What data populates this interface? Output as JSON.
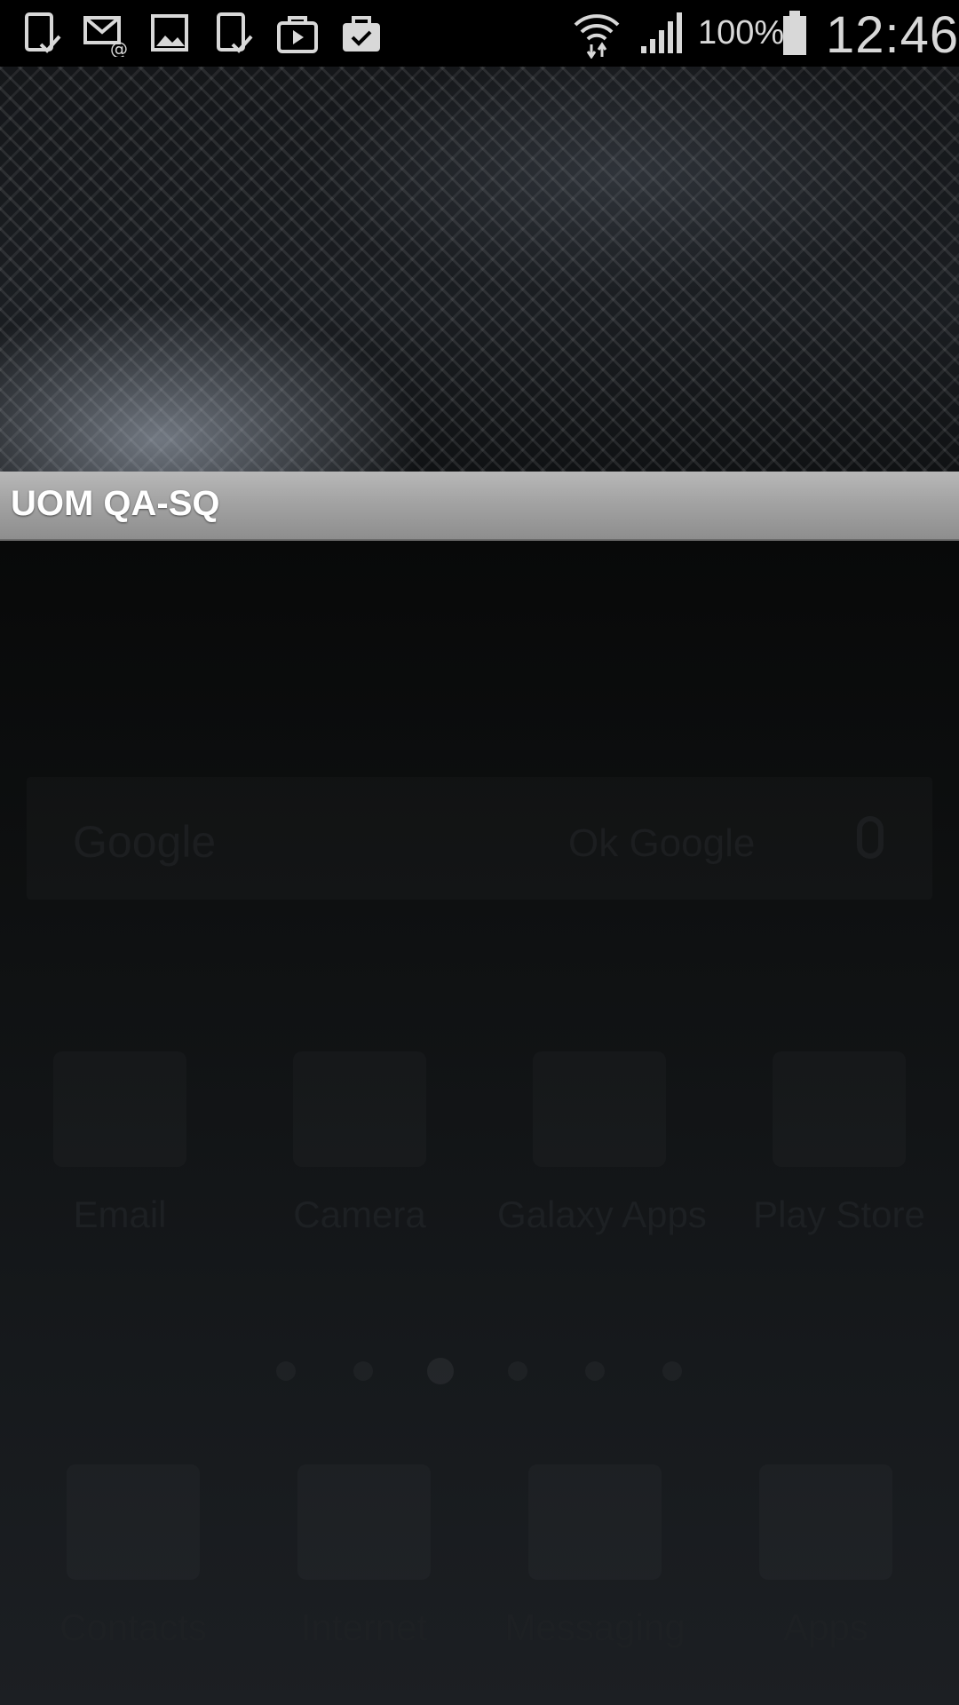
{
  "status_bar": {
    "notification_icons": [
      "device-check-icon",
      "email-at-icon",
      "gallery-image-icon",
      "device-check-icon",
      "play-store-bag-icon",
      "briefcase-check-icon"
    ],
    "system_icons": [
      "wifi-icon",
      "signal-icon",
      "battery-icon"
    ],
    "battery_percent": "100%",
    "time": "12:46"
  },
  "app": {
    "title": "UOM QA-SQ"
  },
  "background_home": {
    "search_widget": {
      "brand": "Google",
      "hint": "Ok Google"
    },
    "apps_row": [
      {
        "label": "Email",
        "icon": "email-icon"
      },
      {
        "label": "Camera",
        "icon": "camera-icon"
      },
      {
        "label": "Galaxy Apps",
        "icon": "galaxy-apps-icon"
      },
      {
        "label": "Play Store",
        "icon": "play-store-icon"
      }
    ],
    "dock": [
      {
        "label": "Contacts",
        "icon": "contacts-icon"
      },
      {
        "label": "Internet",
        "icon": "internet-icon"
      },
      {
        "label": "Messaging",
        "icon": "messaging-icon"
      },
      {
        "label": "Apps",
        "icon": "apps-grid-icon"
      }
    ],
    "page_indicator": {
      "count": 6,
      "active_index": 2
    }
  }
}
